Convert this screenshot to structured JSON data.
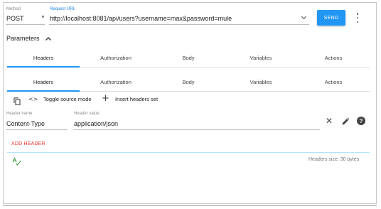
{
  "request": {
    "method_label": "Method",
    "method_value": "POST",
    "url_label": "Request URL",
    "url_value": "http://localhost:8081/api/users?username=max&password=mule",
    "send_label": "SEND"
  },
  "parameters": {
    "title": "Parameters"
  },
  "tabs_primary": [
    "Headers",
    "Authorization",
    "Body",
    "Variables",
    "Actions"
  ],
  "tabs_secondary": [
    "Headers",
    "Authorization",
    "Body",
    "Variables",
    "Actions"
  ],
  "toolbar": {
    "toggle_label": "Toggle source mode",
    "insert_label": "Insert headers set"
  },
  "header_editor": {
    "name_label": "Header name",
    "name_value": "Content-Type",
    "value_label": "Header value",
    "value_value": "application/json",
    "add_header_label": "ADD HEADER",
    "size_label": "Headers size: 30 bytes"
  },
  "colors": {
    "accent": "#2196f3",
    "add_header": "#e53935",
    "valid": "#43a047"
  },
  "icons": [
    "chevron-down-icon",
    "more-vert-icon",
    "chevron-up-icon",
    "copy-icon",
    "code-icon",
    "plus-icon",
    "close-icon",
    "edit-icon",
    "help-icon",
    "spellcheck-icon"
  ]
}
